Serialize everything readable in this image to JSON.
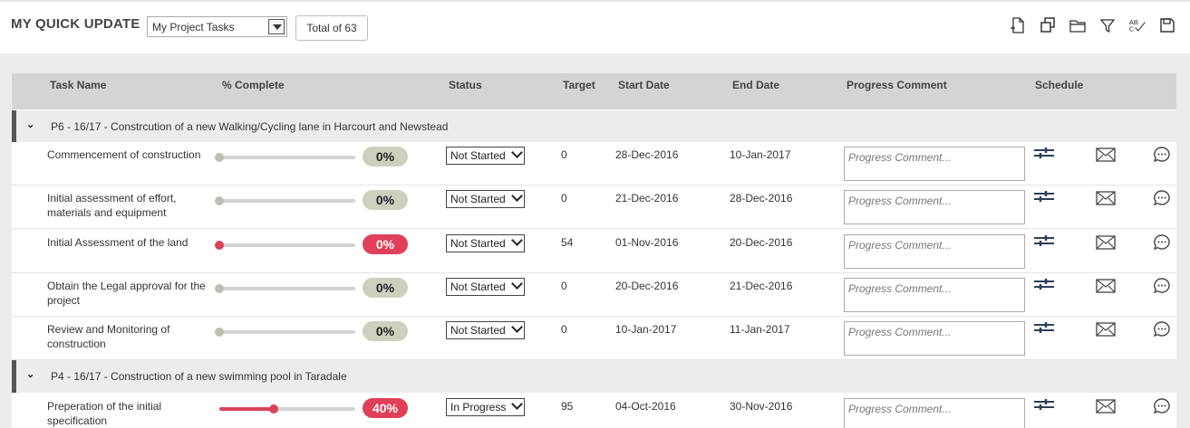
{
  "header": {
    "title": "MY QUICK UPDATE",
    "filter_value": "My Project Tasks",
    "total_label": "Total of 63"
  },
  "toolbar": {
    "icons": [
      "add-page-icon",
      "copy-icon",
      "folder-icon",
      "filter-icon",
      "spellcheck-icon",
      "save-icon"
    ]
  },
  "columns": {
    "task": "Task Name",
    "complete": "% Complete",
    "status": "Status",
    "target": "Target",
    "start": "Start Date",
    "end": "End Date",
    "comment": "Progress Comment",
    "schedule": "Schedule"
  },
  "groups": [
    {
      "title": "P6 - 16/17 - Constrcution of a new Walking/Cycling lane in Harcourt and Newstead",
      "rows": [
        {
          "task": "Commencement of construction",
          "percent": 0,
          "percent_label": "0%",
          "status": "Not Started",
          "target": "0",
          "start": "28-Dec-2016",
          "end": "10-Jan-2017",
          "comment_placeholder": "Progress Comment...",
          "alert": false
        },
        {
          "task": "Initial assessment of effort, materials and equipment",
          "percent": 0,
          "percent_label": "0%",
          "status": "Not Started",
          "target": "0",
          "start": "21-Dec-2016",
          "end": "28-Dec-2016",
          "comment_placeholder": "Progress Comment...",
          "alert": false
        },
        {
          "task": "Initial Assessment of the land",
          "percent": 0,
          "percent_label": "0%",
          "status": "Not Started",
          "target": "54",
          "start": "01-Nov-2016",
          "end": "20-Dec-2016",
          "comment_placeholder": "Progress Comment...",
          "alert": true
        },
        {
          "task": "Obtain the Legal approval for the project",
          "percent": 0,
          "percent_label": "0%",
          "status": "Not Started",
          "target": "0",
          "start": "20-Dec-2016",
          "end": "21-Dec-2016",
          "comment_placeholder": "Progress Comment...",
          "alert": false
        },
        {
          "task": "Review and Monitoring of construction",
          "percent": 0,
          "percent_label": "0%",
          "status": "Not Started",
          "target": "0",
          "start": "10-Jan-2017",
          "end": "11-Jan-2017",
          "comment_placeholder": "Progress Comment...",
          "alert": false
        }
      ]
    },
    {
      "title": "P4 - 16/17 - Construction of a new swimming pool in Taradale",
      "rows": [
        {
          "task": "Preperation of the initial specification",
          "percent": 40,
          "percent_label": "40%",
          "status": "In Progress",
          "target": "95",
          "start": "04-Oct-2016",
          "end": "30-Nov-2016",
          "comment_placeholder": "Progress Comment...",
          "alert": true
        }
      ]
    }
  ],
  "colors": {
    "alert": "#e0405a",
    "neutral_pill": "#cfcfbe",
    "header_bg": "#d4d4d4",
    "icon_blue": "#2c3e5a"
  }
}
